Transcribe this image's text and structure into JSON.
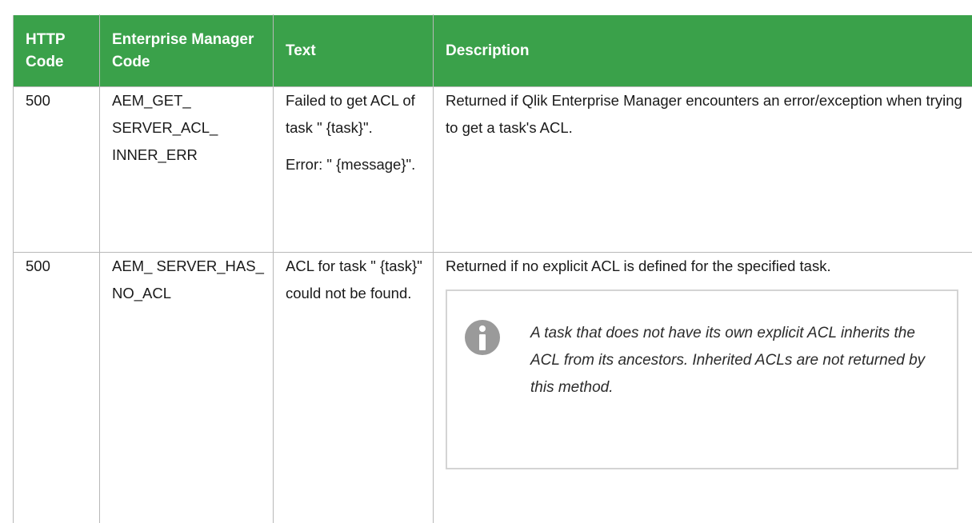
{
  "table": {
    "headers": {
      "code": "HTTP Code",
      "em_code": "Enterprise Manager Code",
      "text": "Text",
      "description": "Description"
    },
    "rows": [
      {
        "code": "500",
        "em_code": "AEM_GET_ SERVER_ACL_ INNER_ERR",
        "text_lines": [
          "Failed to get ACL of task \" {task}\".",
          "Error: \" {message}\"."
        ],
        "description": "Returned if Qlik Enterprise Manager encounters an error/exception when trying to get a task's ACL."
      },
      {
        "code": "500",
        "em_code": "AEM_ SERVER_HAS_ NO_ACL",
        "text_lines": [
          "ACL for task \" {task}\" could not be found."
        ],
        "description": "Returned if no explicit ACL is defined for the specified task.",
        "note": {
          "icon": "info-icon",
          "text": "A task that does not have its own explicit ACL inherits the ACL from its ancestors. Inherited ACLs are not returned by this method."
        }
      }
    ]
  },
  "colors": {
    "header_bg": "#3aa14a",
    "border": "#b8b8b8",
    "note_border": "#d4d4d4",
    "icon_gray": "#9a9a9a"
  }
}
